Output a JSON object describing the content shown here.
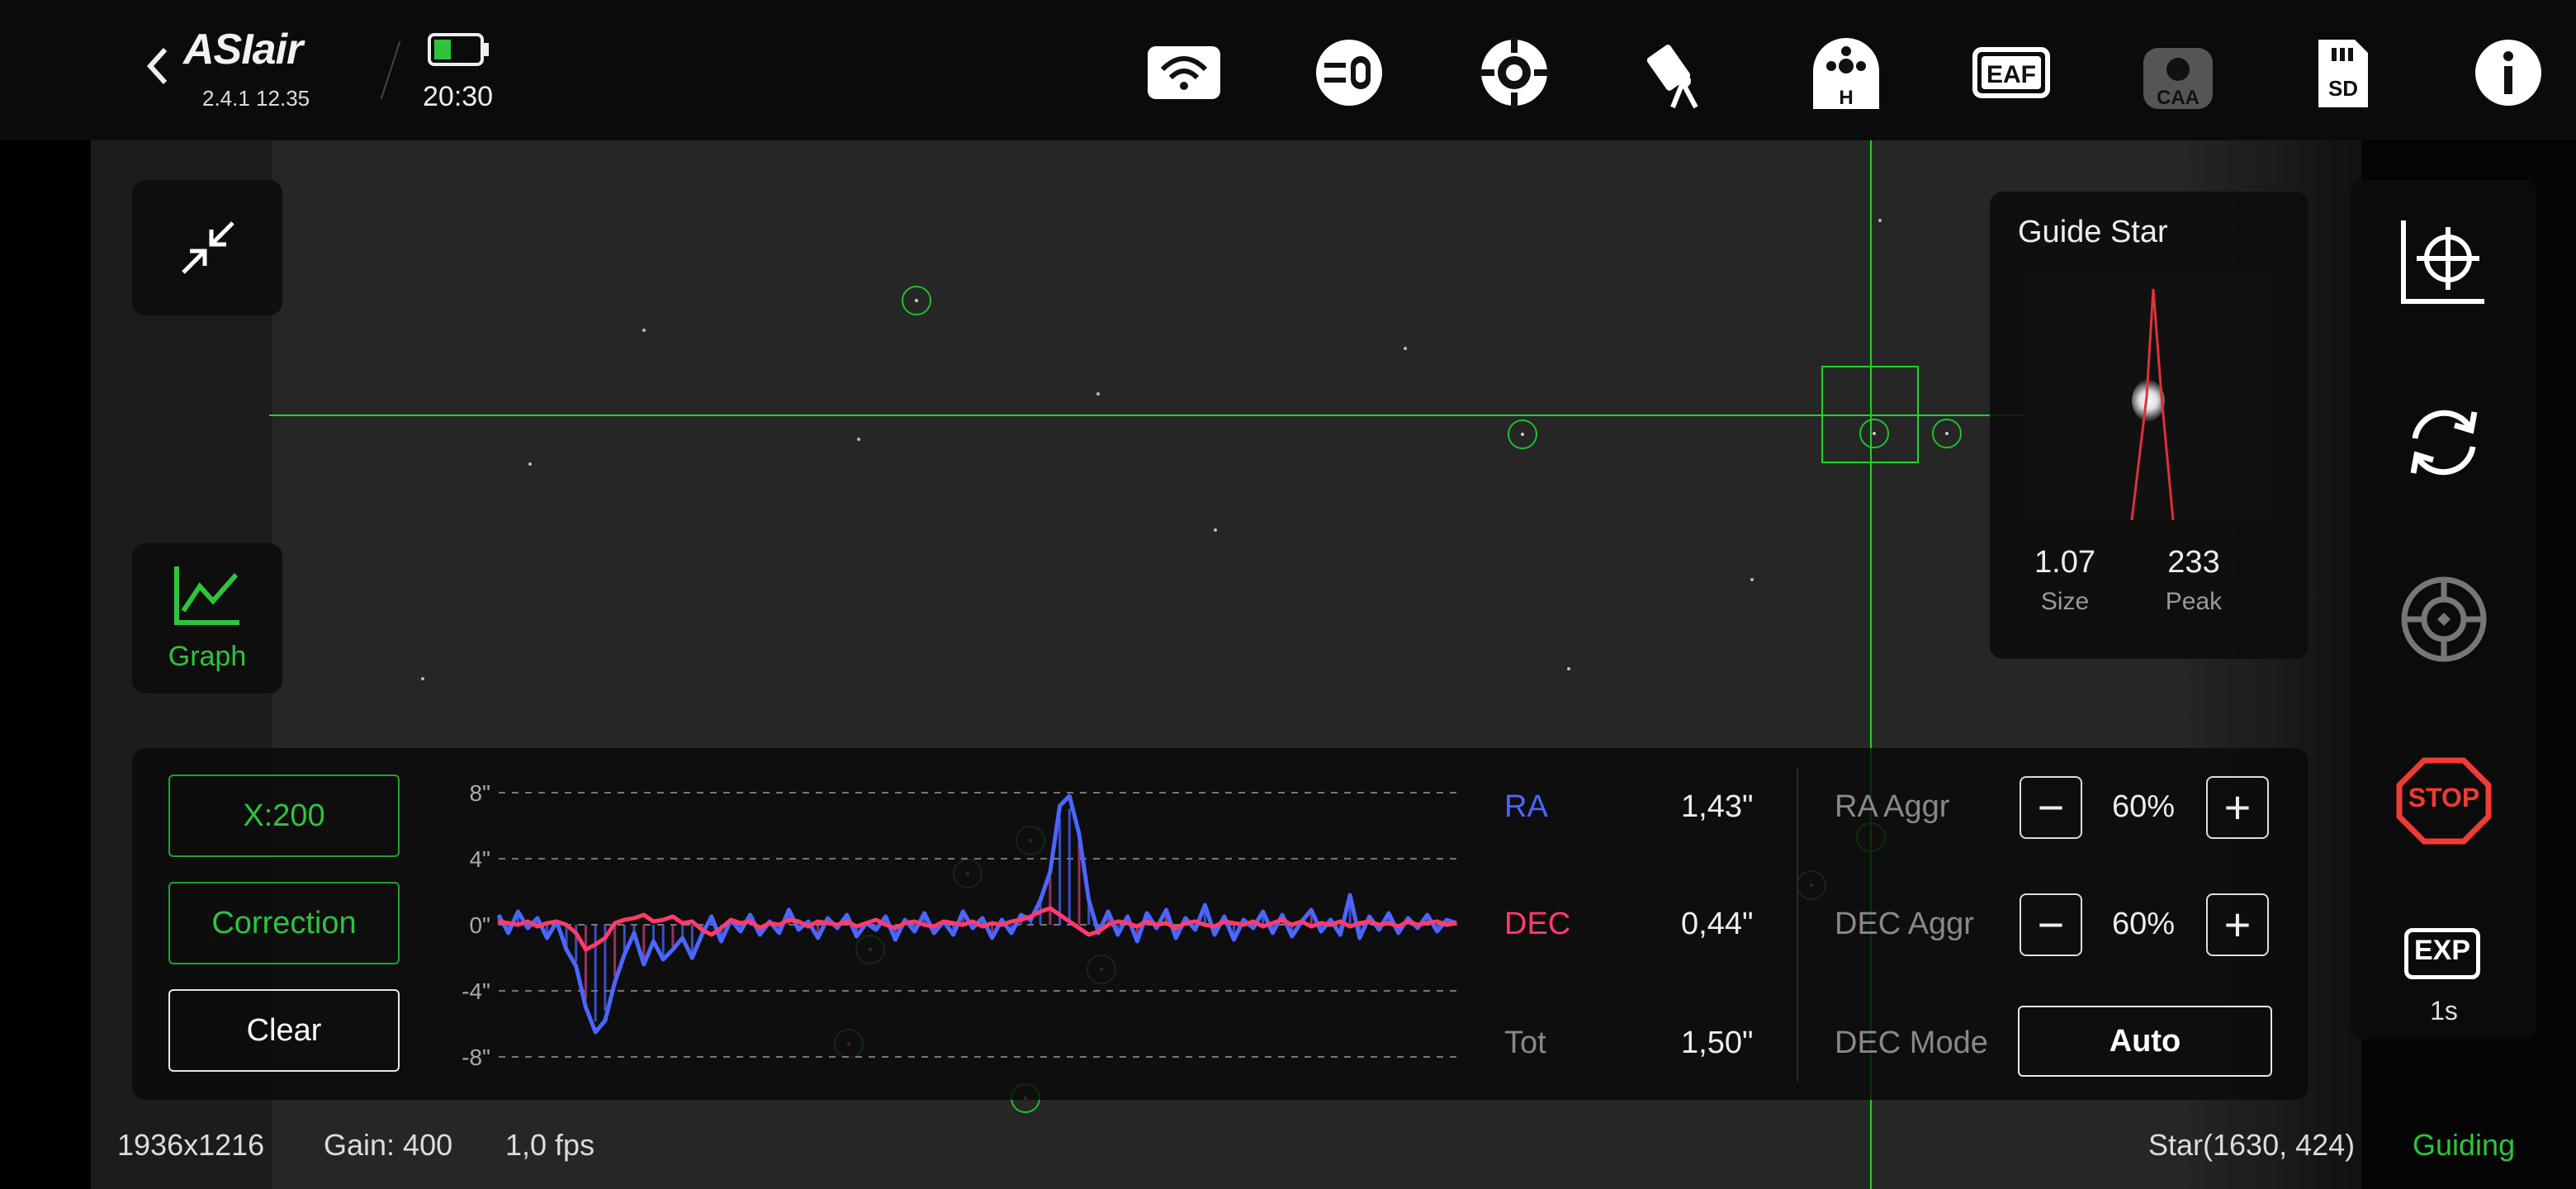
{
  "app": {
    "logo_text": "ASIair",
    "version": "2.4.1 12.35",
    "time": "20:30",
    "battery_icon": "battery-icon"
  },
  "top_icons": [
    "wifi-icon",
    "filter-wheel-icon",
    "mount-icon",
    "telescope-icon",
    "home-icon",
    "eaf-icon",
    "caa-icon",
    "sd-card-icon",
    "info-icon"
  ],
  "top_icon_labels": {
    "home": "H",
    "eaf": "EAF",
    "caa": "CAA",
    "sd": "SD"
  },
  "left_tools": {
    "graph_label": "Graph"
  },
  "guide_star": {
    "title": "Guide Star",
    "size_value": "1.07",
    "size_label": "Size",
    "peak_value": "233",
    "peak_label": "Peak"
  },
  "graph_panel": {
    "scale_button": "X:200",
    "correction_button": "Correction",
    "clear_button": "Clear",
    "y_ticks": [
      "8\"",
      "4\"",
      "0\"",
      "-4\"",
      "-8\""
    ],
    "ra_label": "RA",
    "ra_value": "1,43\"",
    "dec_label": "DEC",
    "dec_value": "0,44\"",
    "tot_label": "Tot",
    "tot_value": "1,50\"",
    "ra_aggr_label": "RA Aggr",
    "ra_aggr_value": "60%",
    "dec_aggr_label": "DEC Aggr",
    "dec_aggr_value": "60%",
    "dec_mode_label": "DEC Mode",
    "dec_mode_value": "Auto",
    "minus": "−",
    "plus": "+",
    "colors": {
      "ra": "#4b66ff",
      "dec": "#ff3b6b",
      "accent": "#2ec43c"
    }
  },
  "right_tools": {
    "stop_label": "STOP",
    "exp_label": "EXP",
    "exp_value": "1s"
  },
  "status": {
    "resolution": "1936x1216",
    "gain": "Gain: 400",
    "fps": "1,0 fps",
    "star_pos": "Star(1630, 424)",
    "state": "Guiding"
  },
  "chart_data": {
    "type": "line",
    "y_ticks": [
      "8\"",
      "4\"",
      "0\"",
      "-4\"",
      "-8\""
    ],
    "ylim": [
      -8,
      8
    ],
    "series": [
      {
        "name": "RA",
        "color": "#4b66ff",
        "values": [
          0.6,
          -0.5,
          0.8,
          -0.2,
          0.4,
          -0.8,
          0.2,
          -1.5,
          -2.5,
          -5.0,
          -6.5,
          -5.8,
          -3.5,
          -1.8,
          -0.5,
          -2.4,
          -1.0,
          -2.1,
          -1.5,
          -0.8,
          -2.0,
          -0.6,
          0.5,
          -1.0,
          0.3,
          -0.4,
          0.6,
          -0.6,
          0.2,
          -0.5,
          0.9,
          -0.3,
          0.2,
          -0.8,
          0.4,
          -0.2,
          0.6,
          -0.7,
          0.1,
          -0.3,
          0.5,
          -0.9,
          0.3,
          -0.4,
          0.7,
          -0.5,
          0.2,
          -0.6,
          0.8,
          -0.2,
          0.4,
          -0.8,
          0.3,
          -0.5,
          0.6,
          0.3,
          1.5,
          3.2,
          7.2,
          7.8,
          5.5,
          1.5,
          -0.5,
          0.8,
          -0.6,
          0.5,
          -1.0,
          0.7,
          -0.2,
          0.9,
          -0.8,
          0.4,
          -0.3,
          1.2,
          -0.6,
          0.5,
          -0.9,
          0.3,
          -0.2,
          0.8,
          -0.5,
          0.6,
          -0.7,
          0.2,
          0.9,
          -0.4,
          0.3,
          -0.6,
          1.8,
          -0.8,
          0.5,
          -0.3,
          0.7,
          -0.5,
          0.4,
          -0.2,
          0.6,
          -0.4,
          0.3,
          0.1
        ]
      },
      {
        "name": "DEC",
        "color": "#ff3b6b",
        "values": [
          0.2,
          0.1,
          0.0,
          0.2,
          -0.1,
          0.1,
          0.2,
          0.0,
          -0.5,
          -1.5,
          -1.2,
          -0.8,
          0.1,
          0.3,
          0.4,
          0.6,
          0.2,
          0.3,
          0.5,
          0.1,
          0.2,
          -0.3,
          -0.6,
          -0.2,
          0.3,
          0.1,
          0.2,
          -0.2,
          0.1,
          0.0,
          0.3,
          0.2,
          -0.1,
          0.2,
          0.1,
          0.0,
          0.2,
          -0.1,
          0.1,
          0.3,
          0.0,
          -0.2,
          0.1,
          0.2,
          0.0,
          -0.1,
          0.2,
          0.1,
          0.0,
          0.2,
          -0.1,
          0.1,
          0.0,
          0.2,
          0.3,
          0.5,
          0.8,
          1.0,
          0.6,
          0.2,
          -0.2,
          -0.6,
          -0.4,
          0.0,
          0.2,
          0.1,
          -0.1,
          0.2,
          0.0,
          0.1,
          -0.2,
          0.1,
          0.2,
          0.0,
          -0.1,
          0.2,
          0.1,
          0.0,
          0.2,
          -0.1,
          0.1,
          0.3,
          0.0,
          0.2,
          -0.1,
          0.1,
          0.0,
          0.2,
          -0.1,
          0.1,
          0.2,
          0.0,
          0.1,
          -0.1,
          0.2,
          0.0,
          0.1,
          0.2,
          0.0,
          0.1
        ]
      }
    ]
  }
}
